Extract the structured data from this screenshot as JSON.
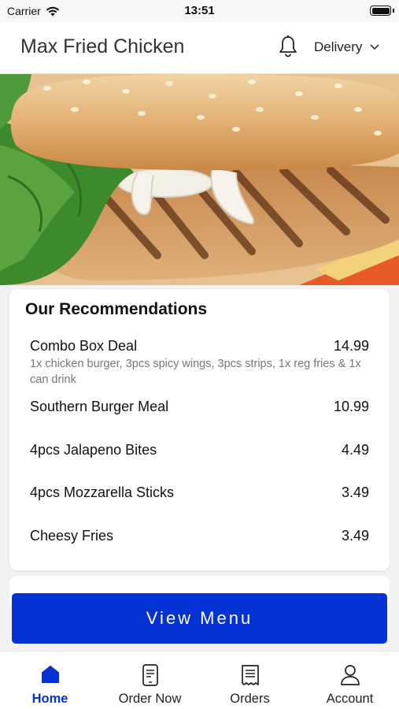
{
  "status": {
    "carrier": "Carrier",
    "time": "13:51"
  },
  "header": {
    "title": "Max Fried Chicken",
    "mode_label": "Delivery"
  },
  "recommendations": {
    "title": "Our Recommendations",
    "items": [
      {
        "name": "Combo Box Deal",
        "price": "14.99",
        "description": "1x chicken burger, 3pcs spicy wings, 3pcs strips, 1x reg fries & 1x can drink"
      },
      {
        "name": "Southern Burger Meal",
        "price": "10.99"
      },
      {
        "name": "4pcs Jalapeno Bites",
        "price": "4.49"
      },
      {
        "name": "4pcs Mozzarella Sticks",
        "price": "3.49"
      },
      {
        "name": "Cheesy Fries",
        "price": "3.49"
      }
    ]
  },
  "view_menu_label": "View Menu",
  "tabs": [
    {
      "label": "Home",
      "icon": "home-icon",
      "active": true
    },
    {
      "label": "Order Now",
      "icon": "phone-order-icon",
      "active": false
    },
    {
      "label": "Orders",
      "icon": "receipt-icon",
      "active": false
    },
    {
      "label": "Account",
      "icon": "person-icon",
      "active": false
    }
  ],
  "colors": {
    "accent": "#0432d4",
    "background": "#f2f2f4"
  }
}
